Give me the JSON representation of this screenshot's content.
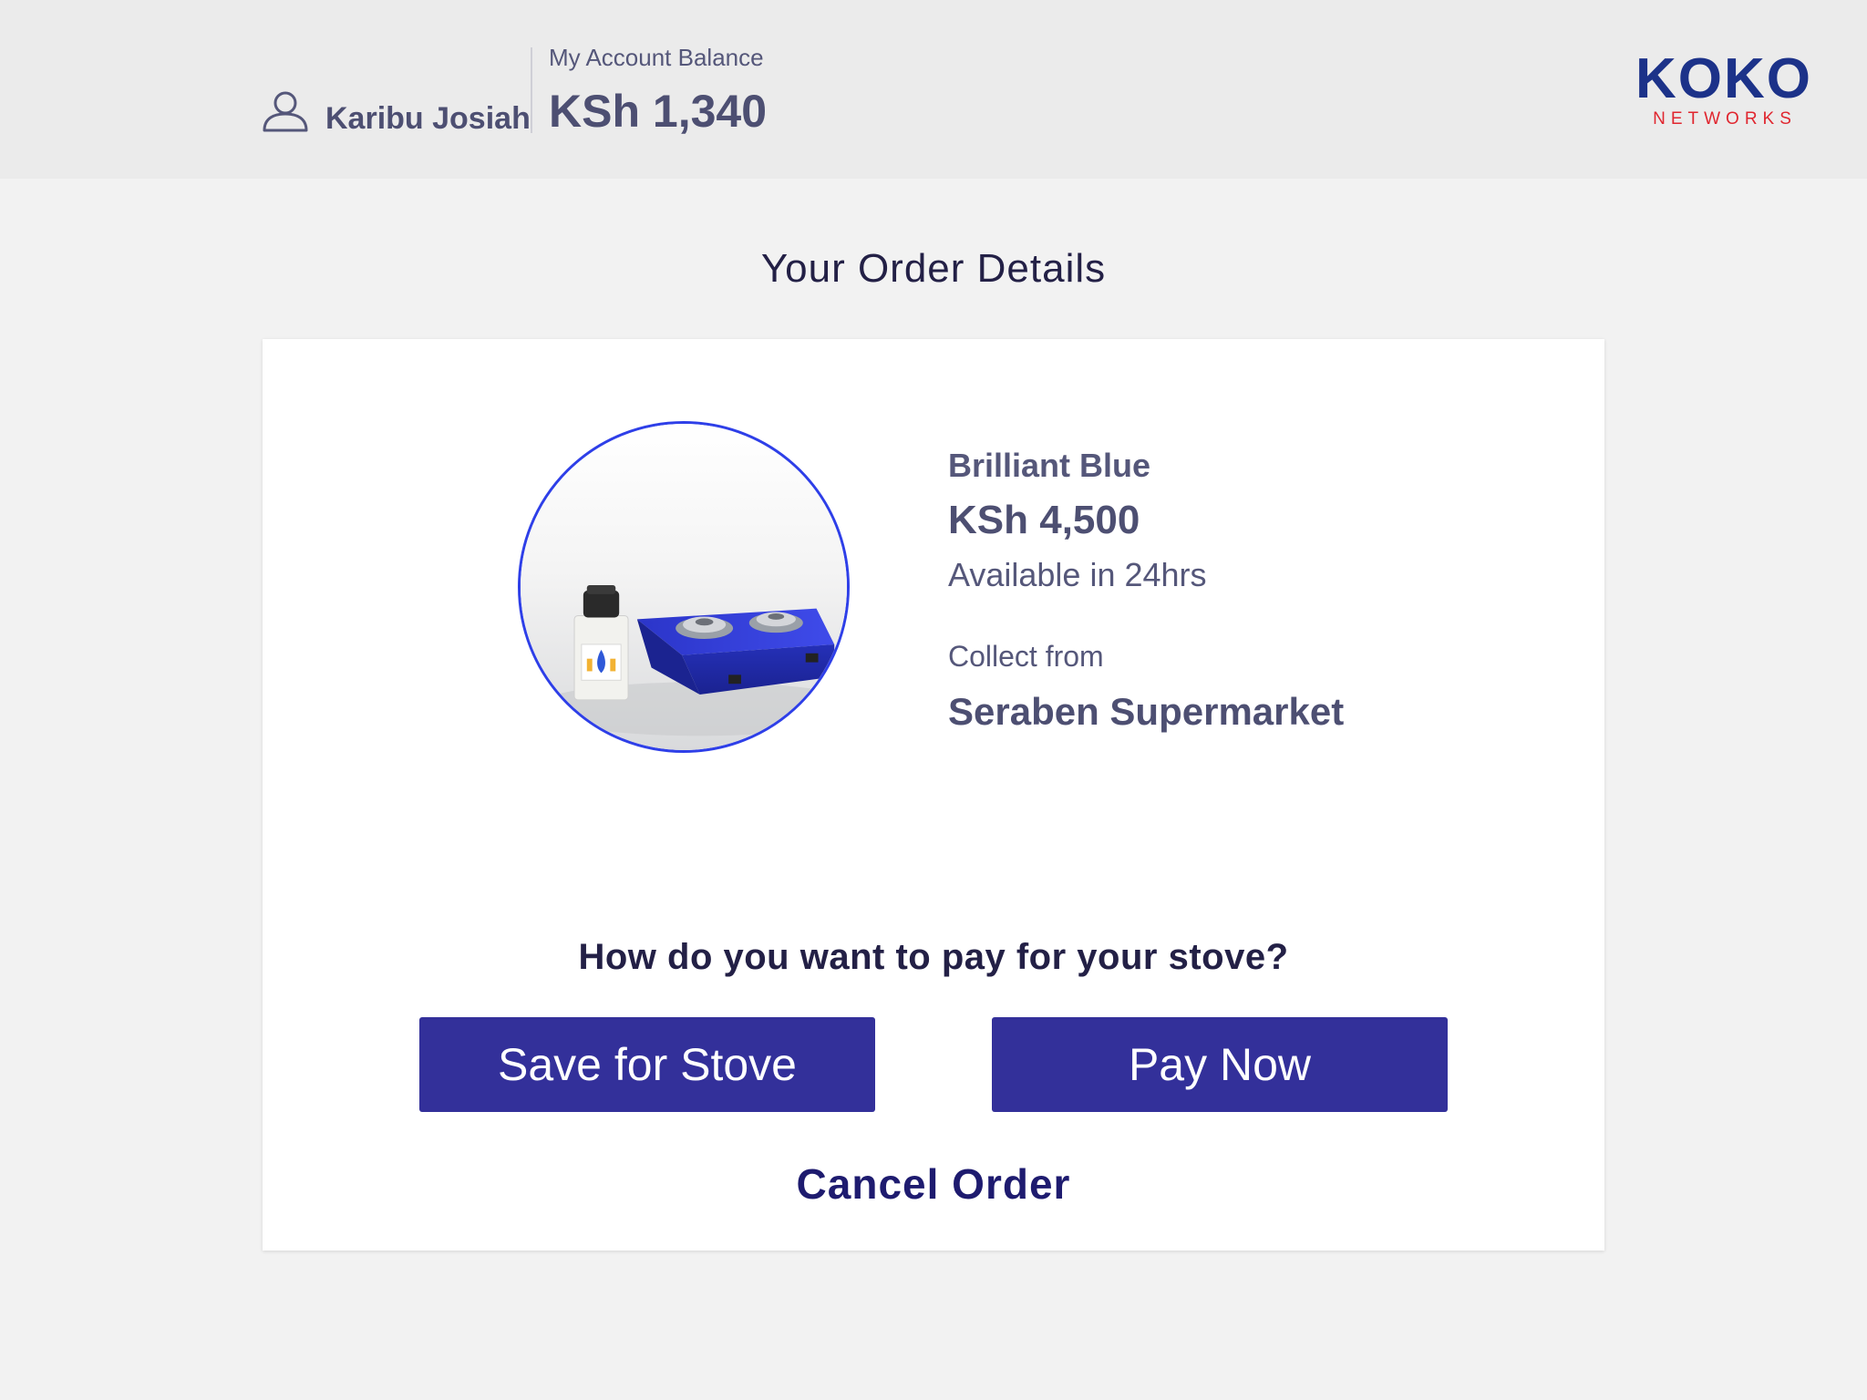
{
  "header": {
    "user_name": "Karibu Josiah",
    "balance_label": "My Account Balance",
    "balance_value": "KSh 1,340",
    "logo_main": "KOKO",
    "logo_sub": "NETWORKS",
    "logo_colors": {
      "main": "#1c3289",
      "sub": "#e0262f"
    }
  },
  "page": {
    "title": "Your Order Details"
  },
  "order": {
    "product_name": "Brilliant Blue",
    "price": "KSh 4,500",
    "availability": "Available in 24hrs",
    "collect_label": "Collect from",
    "collect_location": "Seraben Supermarket",
    "image_icon": "stove-product-image"
  },
  "payment": {
    "question": "How do you want to pay for your stove?",
    "save_label": "Save for Stove",
    "pay_label": "Pay Now",
    "cancel_label": "Cancel Order"
  },
  "colors": {
    "primary_button": "#33309a",
    "image_border": "#2e3fe8",
    "heading": "#232046",
    "body_text": "#4d4f72"
  }
}
